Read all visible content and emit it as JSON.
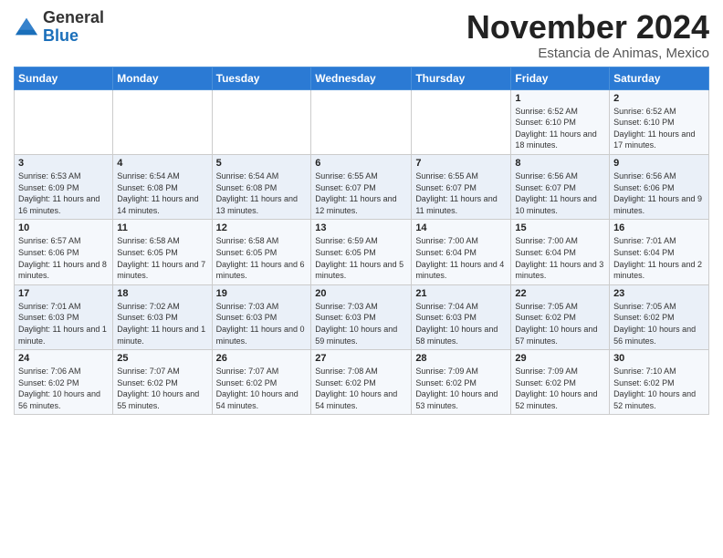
{
  "logo": {
    "general": "General",
    "blue": "Blue"
  },
  "title": "November 2024",
  "location": "Estancia de Animas, Mexico",
  "weekdays": [
    "Sunday",
    "Monday",
    "Tuesday",
    "Wednesday",
    "Thursday",
    "Friday",
    "Saturday"
  ],
  "weeks": [
    [
      {
        "day": "",
        "info": ""
      },
      {
        "day": "",
        "info": ""
      },
      {
        "day": "",
        "info": ""
      },
      {
        "day": "",
        "info": ""
      },
      {
        "day": "",
        "info": ""
      },
      {
        "day": "1",
        "info": "Sunrise: 6:52 AM\nSunset: 6:10 PM\nDaylight: 11 hours and 18 minutes."
      },
      {
        "day": "2",
        "info": "Sunrise: 6:52 AM\nSunset: 6:10 PM\nDaylight: 11 hours and 17 minutes."
      }
    ],
    [
      {
        "day": "3",
        "info": "Sunrise: 6:53 AM\nSunset: 6:09 PM\nDaylight: 11 hours and 16 minutes."
      },
      {
        "day": "4",
        "info": "Sunrise: 6:54 AM\nSunset: 6:08 PM\nDaylight: 11 hours and 14 minutes."
      },
      {
        "day": "5",
        "info": "Sunrise: 6:54 AM\nSunset: 6:08 PM\nDaylight: 11 hours and 13 minutes."
      },
      {
        "day": "6",
        "info": "Sunrise: 6:55 AM\nSunset: 6:07 PM\nDaylight: 11 hours and 12 minutes."
      },
      {
        "day": "7",
        "info": "Sunrise: 6:55 AM\nSunset: 6:07 PM\nDaylight: 11 hours and 11 minutes."
      },
      {
        "day": "8",
        "info": "Sunrise: 6:56 AM\nSunset: 6:07 PM\nDaylight: 11 hours and 10 minutes."
      },
      {
        "day": "9",
        "info": "Sunrise: 6:56 AM\nSunset: 6:06 PM\nDaylight: 11 hours and 9 minutes."
      }
    ],
    [
      {
        "day": "10",
        "info": "Sunrise: 6:57 AM\nSunset: 6:06 PM\nDaylight: 11 hours and 8 minutes."
      },
      {
        "day": "11",
        "info": "Sunrise: 6:58 AM\nSunset: 6:05 PM\nDaylight: 11 hours and 7 minutes."
      },
      {
        "day": "12",
        "info": "Sunrise: 6:58 AM\nSunset: 6:05 PM\nDaylight: 11 hours and 6 minutes."
      },
      {
        "day": "13",
        "info": "Sunrise: 6:59 AM\nSunset: 6:05 PM\nDaylight: 11 hours and 5 minutes."
      },
      {
        "day": "14",
        "info": "Sunrise: 7:00 AM\nSunset: 6:04 PM\nDaylight: 11 hours and 4 minutes."
      },
      {
        "day": "15",
        "info": "Sunrise: 7:00 AM\nSunset: 6:04 PM\nDaylight: 11 hours and 3 minutes."
      },
      {
        "day": "16",
        "info": "Sunrise: 7:01 AM\nSunset: 6:04 PM\nDaylight: 11 hours and 2 minutes."
      }
    ],
    [
      {
        "day": "17",
        "info": "Sunrise: 7:01 AM\nSunset: 6:03 PM\nDaylight: 11 hours and 1 minute."
      },
      {
        "day": "18",
        "info": "Sunrise: 7:02 AM\nSunset: 6:03 PM\nDaylight: 11 hours and 1 minute."
      },
      {
        "day": "19",
        "info": "Sunrise: 7:03 AM\nSunset: 6:03 PM\nDaylight: 11 hours and 0 minutes."
      },
      {
        "day": "20",
        "info": "Sunrise: 7:03 AM\nSunset: 6:03 PM\nDaylight: 10 hours and 59 minutes."
      },
      {
        "day": "21",
        "info": "Sunrise: 7:04 AM\nSunset: 6:03 PM\nDaylight: 10 hours and 58 minutes."
      },
      {
        "day": "22",
        "info": "Sunrise: 7:05 AM\nSunset: 6:02 PM\nDaylight: 10 hours and 57 minutes."
      },
      {
        "day": "23",
        "info": "Sunrise: 7:05 AM\nSunset: 6:02 PM\nDaylight: 10 hours and 56 minutes."
      }
    ],
    [
      {
        "day": "24",
        "info": "Sunrise: 7:06 AM\nSunset: 6:02 PM\nDaylight: 10 hours and 56 minutes."
      },
      {
        "day": "25",
        "info": "Sunrise: 7:07 AM\nSunset: 6:02 PM\nDaylight: 10 hours and 55 minutes."
      },
      {
        "day": "26",
        "info": "Sunrise: 7:07 AM\nSunset: 6:02 PM\nDaylight: 10 hours and 54 minutes."
      },
      {
        "day": "27",
        "info": "Sunrise: 7:08 AM\nSunset: 6:02 PM\nDaylight: 10 hours and 54 minutes."
      },
      {
        "day": "28",
        "info": "Sunrise: 7:09 AM\nSunset: 6:02 PM\nDaylight: 10 hours and 53 minutes."
      },
      {
        "day": "29",
        "info": "Sunrise: 7:09 AM\nSunset: 6:02 PM\nDaylight: 10 hours and 52 minutes."
      },
      {
        "day": "30",
        "info": "Sunrise: 7:10 AM\nSunset: 6:02 PM\nDaylight: 10 hours and 52 minutes."
      }
    ]
  ]
}
